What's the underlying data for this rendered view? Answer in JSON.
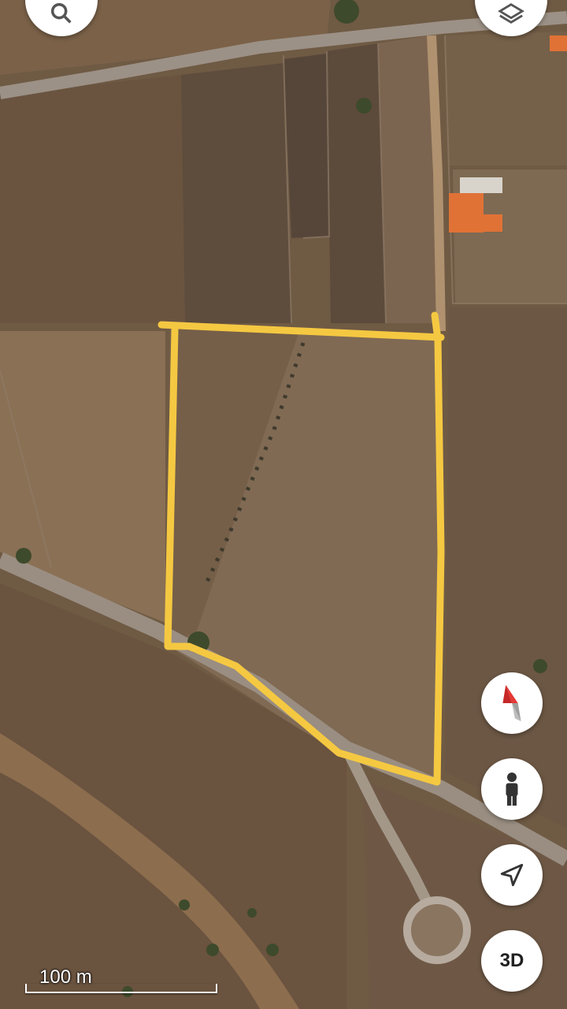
{
  "map": {
    "view": "satellite",
    "boundary_color": "#f5c842",
    "scale_label": "100 m"
  },
  "controls": {
    "search_icon": "search-icon",
    "layers_icon": "layers-icon",
    "compass_icon": "compass-icon",
    "street_view_icon": "pegman-icon",
    "my_location_icon": "navigation-arrow-icon",
    "tilt_label": "3D"
  }
}
